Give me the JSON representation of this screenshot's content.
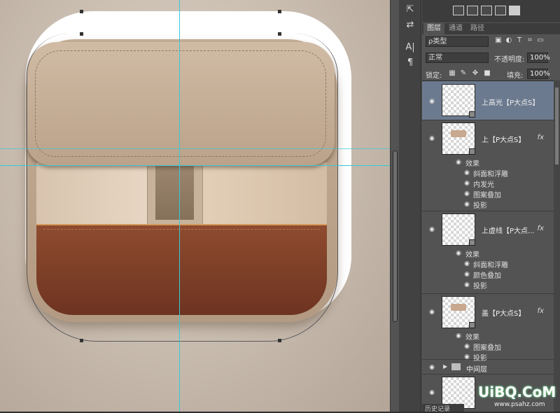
{
  "tools": {
    "icons": [
      "transform-icon",
      "swap-icon",
      "text-tool-icon",
      "paragraph-icon"
    ],
    "text_tool": "A|",
    "paragraph": "¶"
  },
  "panel": {
    "tabs": [
      "图层",
      "通道",
      "路径"
    ],
    "filter_kind": "ρ类型",
    "blend_mode": "正常",
    "opacity_label": "不透明度:",
    "opacity_value": "100%",
    "lock_label": "锁定:",
    "fill_label": "填充:",
    "fill_value": "100%"
  },
  "layers": [
    {
      "name": "上高光【P大点S】",
      "selected": true,
      "fx": "",
      "effects": []
    },
    {
      "name": "上【P大点S】",
      "selected": false,
      "fx": "fx",
      "effects": [
        "效果",
        "斜面和浮雕",
        "内发光",
        "图案叠加",
        "投影"
      ]
    },
    {
      "name": "上虚线【P大点...",
      "selected": false,
      "fx": "fx",
      "effects": [
        "效果",
        "斜面和浮雕",
        "颜色叠加",
        "投影"
      ]
    },
    {
      "name": "盖【P大点S】",
      "selected": false,
      "fx": "fx",
      "effects": [
        "效果",
        "图案叠加",
        "投影"
      ]
    }
  ],
  "group": {
    "name": "中间层"
  },
  "bottom_tab": "历史记录",
  "watermark": {
    "brand": "UiBQ.CoM",
    "sub": "www.psahz.com"
  },
  "colors": {
    "selected_layer": "#6c7a8f",
    "guide": "#38c9d6",
    "leather": "#7d3f27"
  }
}
